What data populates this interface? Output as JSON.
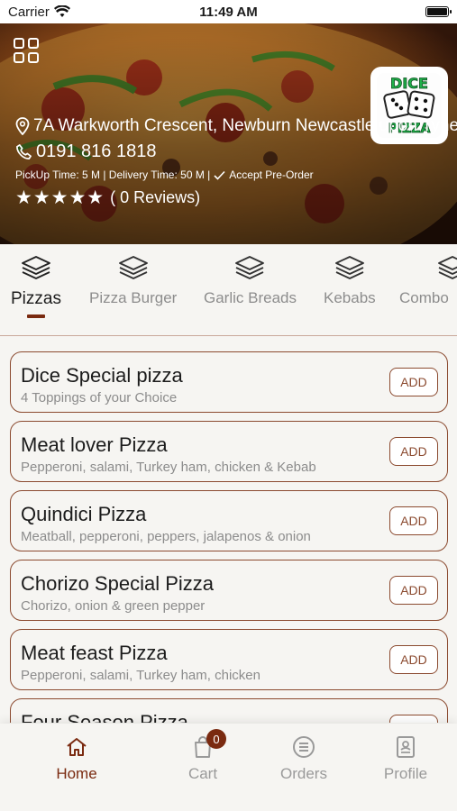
{
  "status_bar": {
    "carrier": "Carrier",
    "time": "11:49 AM"
  },
  "restaurant": {
    "address": "7A Warkworth Crescent, Newburn Newcastle upon Tyne",
    "phone": "0191 816 1818",
    "times": "PickUp Time: 5 M | Delivery Time: 50 M |",
    "preorder": "Accept Pre-Order",
    "rating_stars": "★★★★★",
    "reviews": "( 0 Reviews)",
    "logo_text_top": "DICE",
    "logo_text_bottom": "PIZZA"
  },
  "categories": [
    {
      "label": "Pizzas",
      "active": true
    },
    {
      "label": "Pizza Burger"
    },
    {
      "label": "Garlic Breads"
    },
    {
      "label": "Kebabs"
    },
    {
      "label": "Combo"
    }
  ],
  "products": [
    {
      "name": "Dice Special pizza",
      "description": "4 Toppings of your Choice",
      "button": "ADD"
    },
    {
      "name": "Meat lover Pizza",
      "description": "Pepperoni, salami, Turkey ham, chicken & Kebab",
      "button": "ADD"
    },
    {
      "name": "Quindici Pizza",
      "description": "Meatball, pepperoni, peppers, jalapenos & onion",
      "button": "ADD"
    },
    {
      "name": "Chorizo Special Pizza",
      "description": "Chorizo, onion & green pepper",
      "button": "ADD"
    },
    {
      "name": "Meat feast Pizza",
      "description": "Pepperoni, salami, Turkey ham, chicken",
      "button": "ADD"
    },
    {
      "name": "Four Season Pizza",
      "description": "",
      "button": "ADD"
    }
  ],
  "nav": {
    "home": "Home",
    "cart": "Cart",
    "cart_count": "0",
    "orders": "Orders",
    "profile": "Profile"
  },
  "colors": {
    "accent": "#7a2a10",
    "card_border": "#8b4a2f",
    "muted": "#8c8c8c"
  }
}
